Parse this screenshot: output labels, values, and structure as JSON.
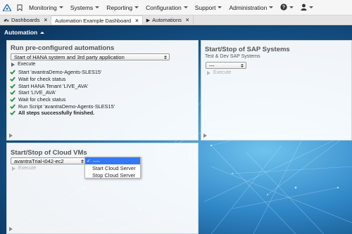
{
  "topbar": {
    "menus": [
      {
        "label": "Monitoring"
      },
      {
        "label": "Systems"
      },
      {
        "label": "Reporting"
      },
      {
        "label": "Configuration"
      },
      {
        "label": "Support"
      },
      {
        "label": "Administration"
      }
    ],
    "help_icon": "?",
    "user_icon": "user-icon"
  },
  "tabs": [
    {
      "label": "Dashboards",
      "closable": true,
      "active": false
    },
    {
      "label": "Automation Example Dashboard",
      "closable": true,
      "active": true
    },
    {
      "label": "Automations",
      "closable": true,
      "active": false
    }
  ],
  "dashboard": {
    "section_title": "Automation",
    "colors": {
      "accent": "#3478f6",
      "check": "#2e8b3e"
    }
  },
  "preconfigured": {
    "title": "Run pre-configured automations",
    "selected": "Start of HANA system and 3rd party application",
    "execute_label": "Execute",
    "steps": [
      "Start 'avantraDemo-Agents-SLES15'",
      "Wait for check status",
      "Start HANA Tenant 'LIVE_AVA'",
      "Start 'LIVE_AVA'",
      "Wait for check status",
      "Run Script 'avantraDemo-Agents-SLES15'",
      "All steps successfully finished."
    ]
  },
  "sap": {
    "title": "Start/Stop of SAP Systems",
    "subtitle": "Test & Dev SAP Systems",
    "selected": "---",
    "execute_label": "Execute"
  },
  "cloud": {
    "title": "Start/Stop of Cloud VMs",
    "selected": "avantraTrial-i042-ec2",
    "execute_label": "Execute",
    "dropdown_options": [
      "----",
      "Start Cloud Server",
      "Stop Cloud Server"
    ]
  }
}
